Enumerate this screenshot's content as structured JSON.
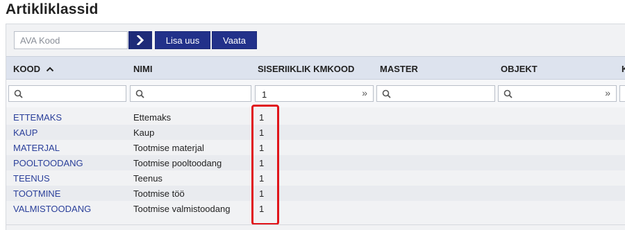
{
  "page": {
    "title": "Artikliklassid"
  },
  "toolbar": {
    "search_placeholder": "AVA Kood",
    "go_icon": "chevron-right-icon",
    "add_label": "Lisa uus",
    "view_label": "Vaata"
  },
  "columns": [
    "KOOD",
    "NIMI",
    "SISERIIKLIK KMKOOD",
    "MASTER",
    "OBJEKT",
    "K"
  ],
  "sort": {
    "column": "KOOD",
    "direction": "asc",
    "icon": "chevron-up-icon"
  },
  "filters": {
    "kood": "",
    "nimi": "",
    "siseriiklik_kmkood": "1",
    "master": "",
    "objekt": ""
  },
  "rows": [
    {
      "kood": "ETTEMAKS",
      "nimi": "Ettemaks",
      "siseriiklik_kmkood": "1"
    },
    {
      "kood": "KAUP",
      "nimi": "Kaup",
      "siseriiklik_kmkood": "1"
    },
    {
      "kood": "MATERJAL",
      "nimi": "Tootmise materjal",
      "siseriiklik_kmkood": "1"
    },
    {
      "kood": "POOLTOODANG",
      "nimi": "Tootmise pooltoodang",
      "siseriiklik_kmkood": "1"
    },
    {
      "kood": "TEENUS",
      "nimi": "Teenus",
      "siseriiklik_kmkood": "1"
    },
    {
      "kood": "TOOTMINE",
      "nimi": "Tootmise töö",
      "siseriiklik_kmkood": "1"
    },
    {
      "kood": "VALMISTOODANG",
      "nimi": "Tootmise valmistoodang",
      "siseriiklik_kmkood": "1"
    }
  ],
  "colors": {
    "accent": "#22318a",
    "link": "#2a3f9a",
    "highlight": "#e0141a",
    "header_bg": "#dde3ee"
  }
}
